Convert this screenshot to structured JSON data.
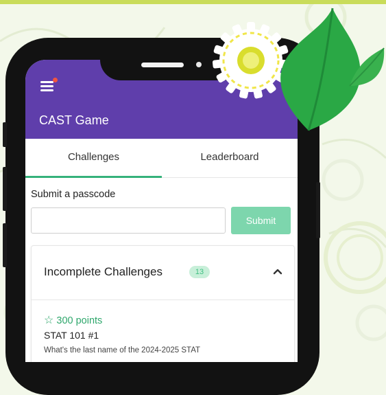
{
  "app": {
    "title": "CAST Game",
    "menu_icon": "hamburger-menu-icon",
    "accent": "#5f3eab",
    "green": "#35b27a"
  },
  "tabs": [
    {
      "label": "Challenges",
      "active": true
    },
    {
      "label": "Leaderboard",
      "active": false
    }
  ],
  "passcode": {
    "label": "Submit a passcode",
    "value": "",
    "placeholder": "",
    "submit_label": "Submit"
  },
  "incomplete": {
    "title": "Incomplete Challenges",
    "count": "13",
    "expanded": true,
    "challenges": [
      {
        "points": "300 points",
        "name": "STAT 101 #1",
        "description": "What's the last name of the 2024-2025 STAT"
      }
    ]
  }
}
